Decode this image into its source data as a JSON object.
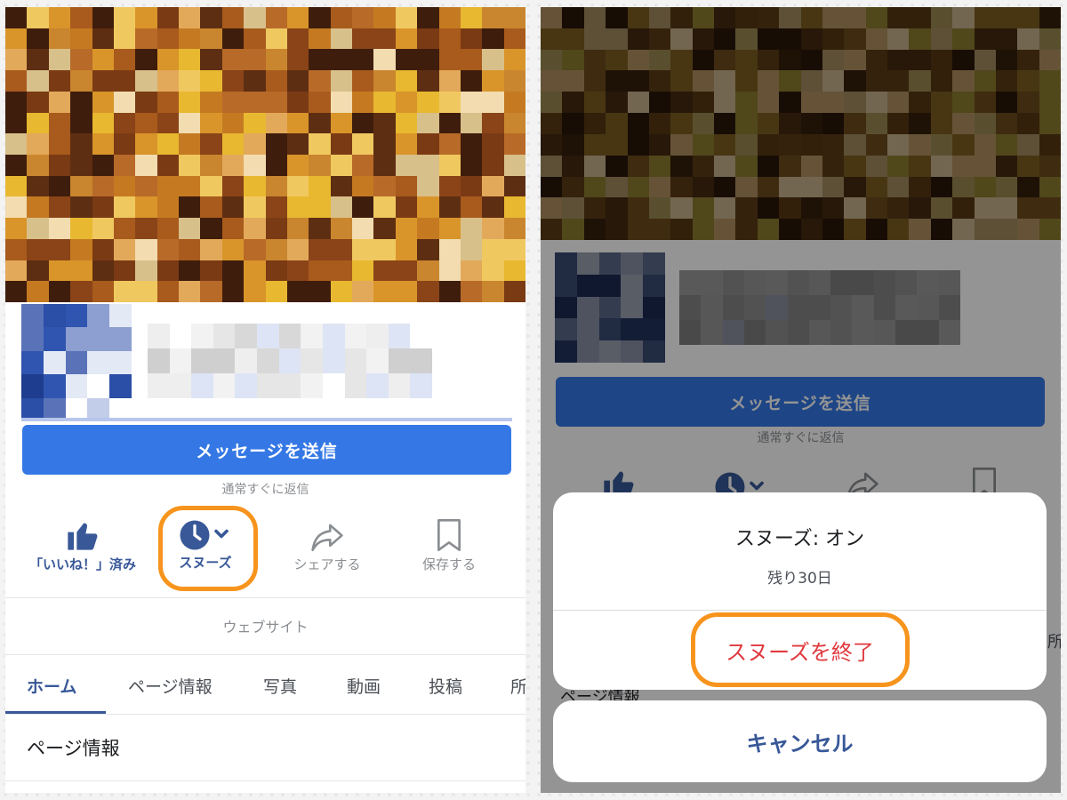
{
  "left": {
    "send_message": "メッセージを送信",
    "reply_note": "通常すぐに返信",
    "actions": [
      {
        "icon": "thumbs-up-icon",
        "label": "「いいね！」済み"
      },
      {
        "icon": "clock-icon",
        "label": "スヌーズ"
      },
      {
        "icon": "share-icon",
        "label": "シェアする"
      },
      {
        "icon": "bookmark-icon",
        "label": "保存する"
      }
    ],
    "website": "ウェブサイト",
    "tabs": [
      "ホーム",
      "ページ情報",
      "写真",
      "動画",
      "投稿",
      "所"
    ],
    "section_title": "ページ情報"
  },
  "right": {
    "send_message": "メッセージを送信",
    "reply_note": "通常すぐに返信",
    "behind_label": "ページ情報",
    "behind_tab_fragment": "所",
    "sheet": {
      "title": "スヌーズ: オン",
      "subtitle": "残り30日",
      "end_snooze": "スヌーズを終了",
      "cancel": "キャンセル"
    }
  },
  "colors": {
    "accent_blue": "#3578e5",
    "label_blue": "#385898",
    "highlight_orange": "#f7941d",
    "end_snooze_red": "#e0393e"
  }
}
